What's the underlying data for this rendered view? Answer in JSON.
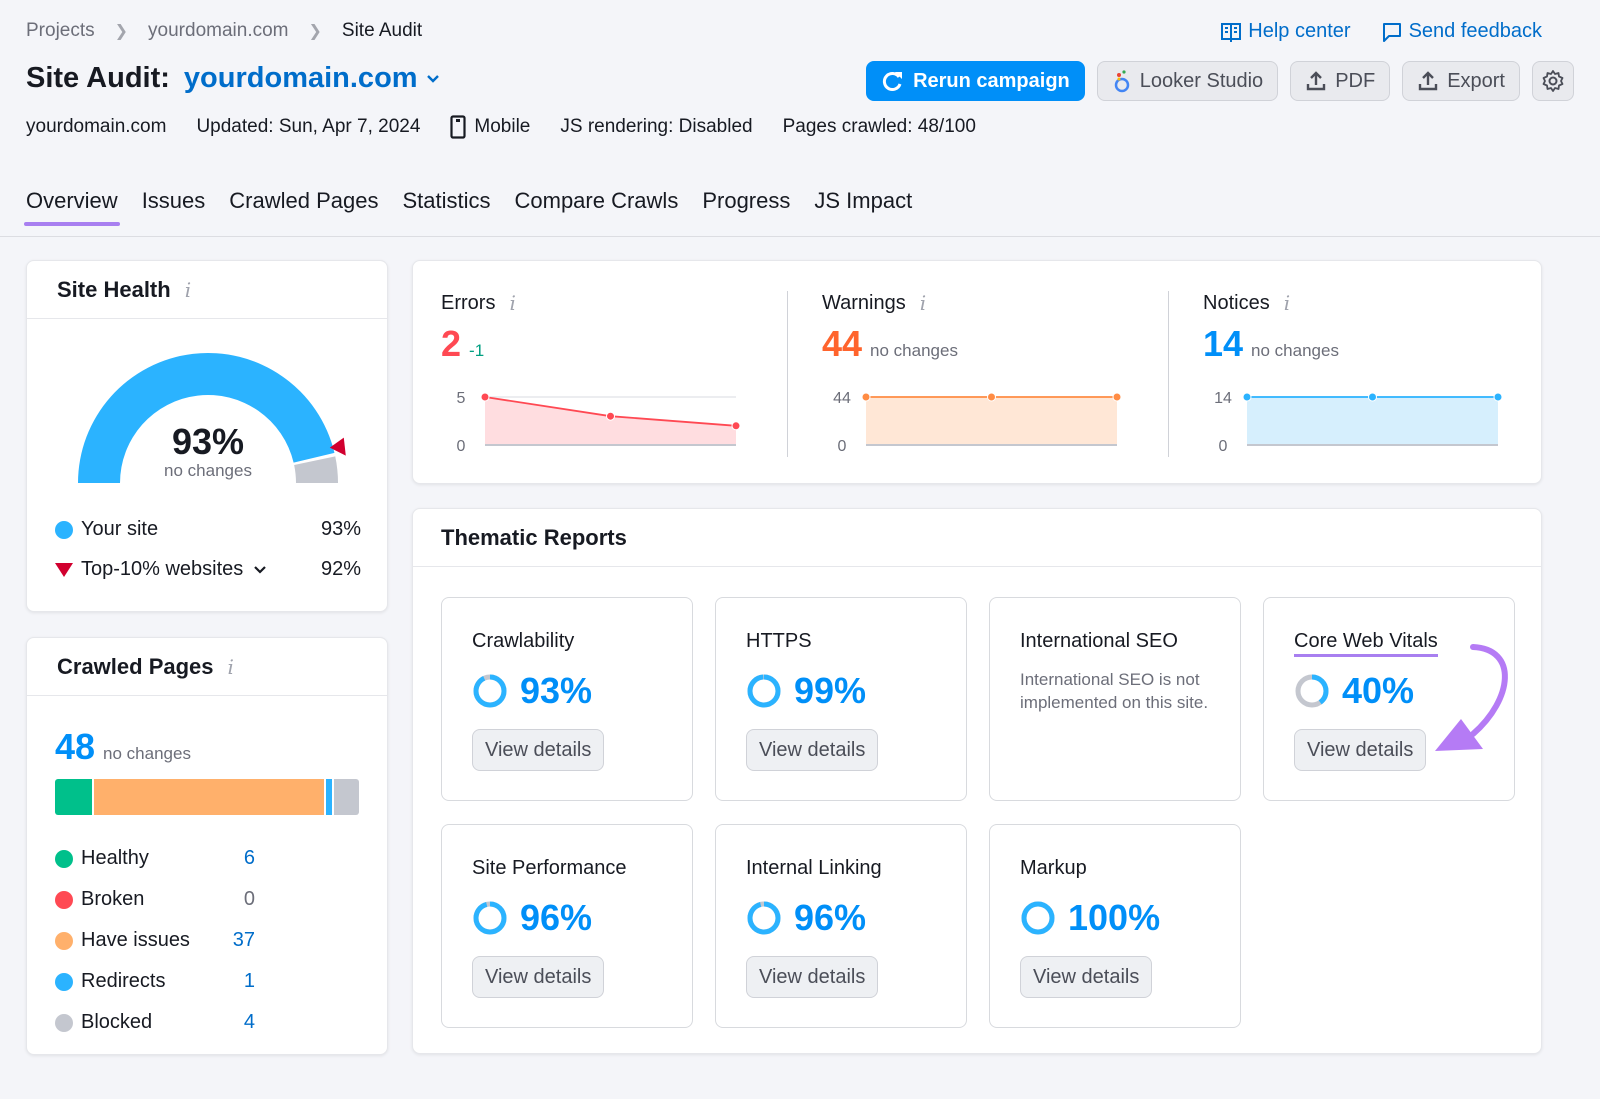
{
  "breadcrumb": [
    "Projects",
    "yourdomain.com",
    "Site Audit"
  ],
  "top_links": {
    "help": "Help center",
    "feedback": "Send feedback"
  },
  "title": {
    "prefix": "Site Audit:",
    "domain": "yourdomain.com"
  },
  "actions": {
    "rerun": "Rerun campaign",
    "looker": "Looker Studio",
    "pdf": "PDF",
    "export": "Export"
  },
  "meta": {
    "domain": "yourdomain.com",
    "updated": "Updated: Sun, Apr 7, 2024",
    "device": "Mobile",
    "js": "JS rendering: Disabled",
    "pages": "Pages crawled: 48/100"
  },
  "tabs": [
    "Overview",
    "Issues",
    "Crawled Pages",
    "Statistics",
    "Compare Crawls",
    "Progress",
    "JS Impact"
  ],
  "site_health": {
    "title": "Site Health",
    "value": "93%",
    "value_num": 93,
    "top10_num": 92,
    "change": "no changes",
    "legend": [
      {
        "label": "Your site",
        "value": "93%"
      },
      {
        "label": "Top-10% websites",
        "value": "92%"
      }
    ]
  },
  "crawled_pages": {
    "title": "Crawled Pages",
    "total": "48",
    "change": "no changes",
    "items": [
      {
        "label": "Healthy",
        "value": "6",
        "count": 6,
        "color": "#00c08b"
      },
      {
        "label": "Broken",
        "value": "0",
        "count": 0,
        "color": "#ff4953"
      },
      {
        "label": "Have issues",
        "value": "37",
        "count": 37,
        "color": "#ffb06b"
      },
      {
        "label": "Redirects",
        "value": "1",
        "count": 1,
        "color": "#2bb3ff"
      },
      {
        "label": "Blocked",
        "value": "4",
        "count": 4,
        "color": "#c4c7cf"
      }
    ]
  },
  "issues": [
    {
      "label": "Errors",
      "value": "2",
      "change": "-1",
      "color": "#ff4953",
      "fill": "#ffdde0",
      "ymax": "5",
      "ymin": "0",
      "series": [
        5,
        3,
        2
      ],
      "yrange": [
        0,
        5
      ]
    },
    {
      "label": "Warnings",
      "value": "44",
      "change": "no changes",
      "color": "#ff642d",
      "line": "#ff8c44",
      "fill": "#ffe7d6",
      "ymax": "44",
      "ymin": "0",
      "series": [
        44,
        44,
        44
      ],
      "yrange": [
        0,
        44
      ]
    },
    {
      "label": "Notices",
      "value": "14",
      "change": "no changes",
      "color": "#008ff8",
      "line": "#2bb3ff",
      "fill": "#d6effd",
      "ymax": "14",
      "ymin": "0",
      "series": [
        14,
        14,
        14
      ],
      "yrange": [
        0,
        14
      ]
    }
  ],
  "thematic": {
    "title": "Thematic Reports",
    "view_details": "View details",
    "reports": [
      {
        "name": "Crawlability",
        "pct": "93%",
        "value": 93
      },
      {
        "name": "HTTPS",
        "pct": "99%",
        "value": 99
      },
      {
        "name": "International SEO",
        "desc": "International SEO is not implemented on this site."
      },
      {
        "name": "Core Web Vitals",
        "pct": "40%",
        "value": 40
      },
      {
        "name": "Site Performance",
        "pct": "96%",
        "value": 96
      },
      {
        "name": "Internal Linking",
        "pct": "96%",
        "value": 96
      },
      {
        "name": "Markup",
        "pct": "100%",
        "value": 100
      }
    ]
  }
}
